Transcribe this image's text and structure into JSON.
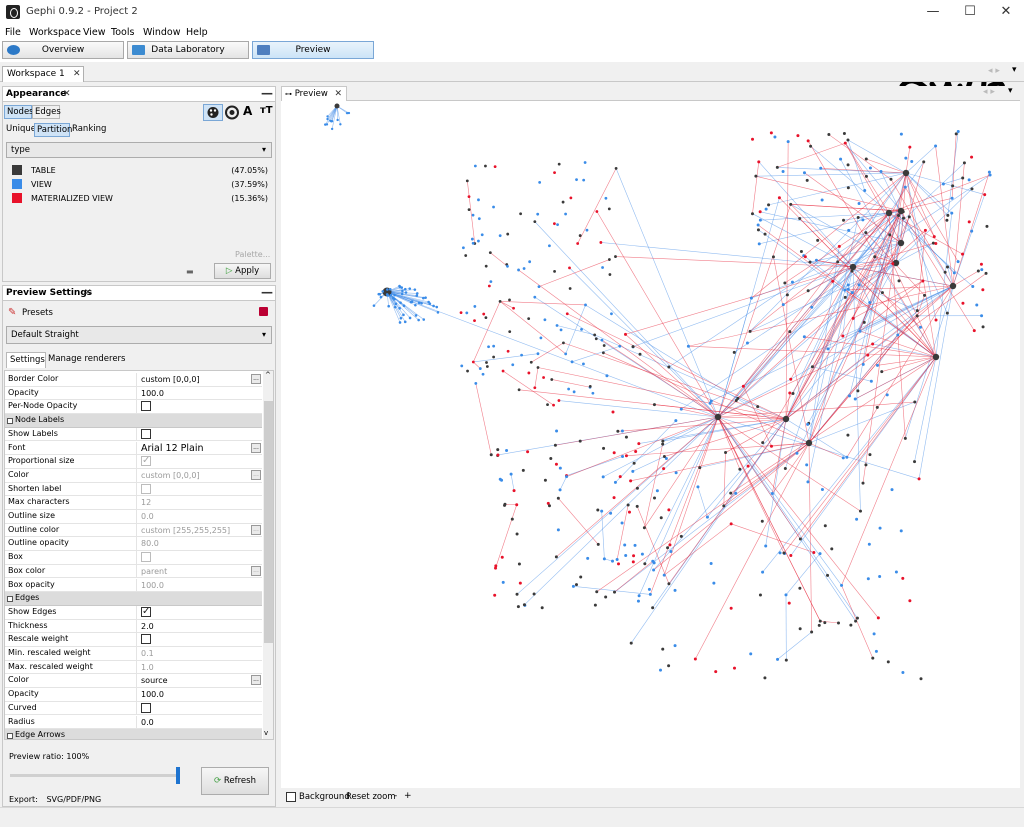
{
  "window": {
    "title": "Gephi 0.9.2 - Project 2",
    "minimize": "—",
    "maximize": "☐",
    "close": "✕"
  },
  "menu": [
    "File",
    "Workspace",
    "View",
    "Tools",
    "Window",
    "Help"
  ],
  "toolbar": {
    "overview": "Overview",
    "data_lab": "Data Laboratory",
    "preview": "Preview"
  },
  "workspace_tab": {
    "label": "Workspace 1",
    "close": "✕"
  },
  "appearance": {
    "title": "Appearance",
    "close": "✕",
    "minimize": "—",
    "tabs": [
      "Nodes",
      "Edges"
    ],
    "modes": [
      "Unique",
      "Partition",
      "Ranking"
    ],
    "attribute": "type",
    "partitions": [
      {
        "name": "TABLE",
        "pct": "(47.05%)",
        "color": "#3a3a3a"
      },
      {
        "name": "VIEW",
        "pct": "(37.59%)",
        "color": "#3a8ce8"
      },
      {
        "name": "MATERIALIZED VIEW",
        "pct": "(15.36%)",
        "color": "#e8122a"
      }
    ],
    "palette": "Palette...",
    "apply": "Apply"
  },
  "preview_settings": {
    "title": "Preview Settings",
    "close": "✕",
    "minimize": "—",
    "presets": "Presets",
    "preset_value": "Default Straight",
    "tabs": [
      "Settings",
      "Manage renderers"
    ],
    "rows": [
      {
        "name": "Border Color",
        "value": "custom [0,0,0]",
        "dots": true
      },
      {
        "name": "Opacity",
        "value": "100.0"
      },
      {
        "name": "Per-Node Opacity",
        "check": false
      },
      {
        "section": "Node Labels"
      },
      {
        "name": "Show Labels",
        "check": false
      },
      {
        "name": "Font",
        "value": "Arial 12 Plain",
        "dots": true,
        "big": true
      },
      {
        "name": "Proportional size",
        "check": true,
        "disabled": true
      },
      {
        "name": "Color",
        "value": "custom [0,0,0]",
        "disabled": true,
        "dots": true
      },
      {
        "name": "Shorten label",
        "check": false,
        "disabled": true
      },
      {
        "name": "Max characters",
        "value": "12",
        "disabled": true
      },
      {
        "name": "Outline size",
        "value": "0.0",
        "disabled": true
      },
      {
        "name": "Outline color",
        "value": "custom [255,255,255]",
        "disabled": true,
        "dots": true
      },
      {
        "name": "Outline opacity",
        "value": "80.0",
        "disabled": true
      },
      {
        "name": "Box",
        "check": false,
        "disabled": true
      },
      {
        "name": "Box color",
        "value": "parent",
        "disabled": true,
        "dots": true
      },
      {
        "name": "Box opacity",
        "value": "100.0",
        "disabled": true
      },
      {
        "section": "Edges"
      },
      {
        "name": "Show Edges",
        "check": true
      },
      {
        "name": "Thickness",
        "value": "2.0"
      },
      {
        "name": "Rescale weight",
        "check": false
      },
      {
        "name": "Min. rescaled weight",
        "value": "0.1",
        "disabled": true
      },
      {
        "name": "Max. rescaled weight",
        "value": "1.0",
        "disabled": true
      },
      {
        "name": "Color",
        "value": "source",
        "dots": true
      },
      {
        "name": "Opacity",
        "value": "100.0"
      },
      {
        "name": "Curved",
        "check": false
      },
      {
        "name": "Radius",
        "value": "0.0"
      },
      {
        "section": "Edge Arrows"
      }
    ],
    "ratio_label": "Preview ratio:",
    "ratio_value": "100%",
    "ratio_fraction": 1.0,
    "refresh": "Refresh",
    "export_label": "Export:",
    "export_value": "SVG/PDF/PNG"
  },
  "preview_tab": {
    "label": "Preview",
    "close": "✕"
  },
  "preview_bottom": {
    "background": "Background",
    "reset_zoom": "Reset zoom",
    "minus": "-",
    "plus": "+"
  }
}
